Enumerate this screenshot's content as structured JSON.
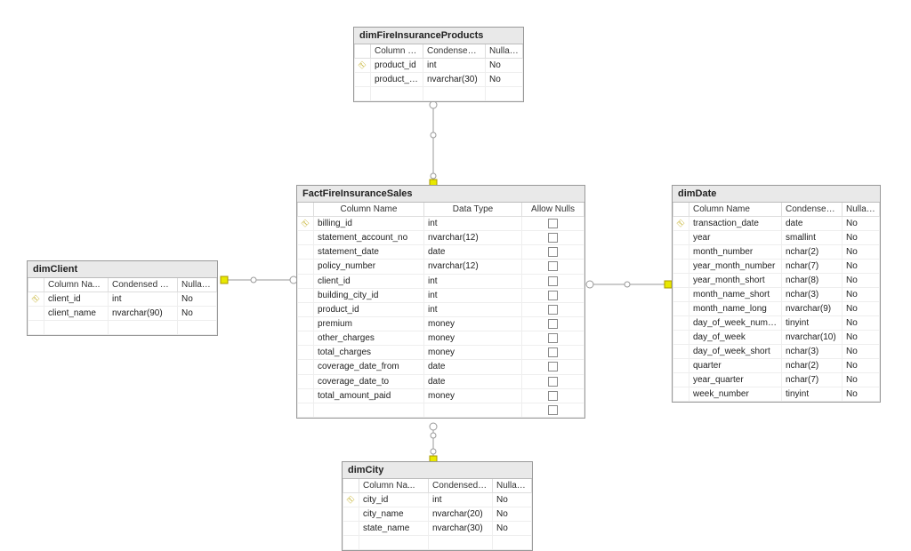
{
  "tables": {
    "dimFireInsuranceProducts": {
      "title": "dimFireInsuranceProducts",
      "headers": [
        "Column Name",
        "Condensed Ty...",
        "Nullable"
      ],
      "rows": [
        {
          "pk": true,
          "c0": "product_id",
          "c1": "int",
          "c2": "No"
        },
        {
          "pk": false,
          "c0": "product_name",
          "c1": "nvarchar(30)",
          "c2": "No"
        }
      ]
    },
    "dimClient": {
      "title": "dimClient",
      "headers": [
        "Column Na...",
        "Condensed Ty...",
        "Nullable"
      ],
      "rows": [
        {
          "pk": true,
          "c0": "client_id",
          "c1": "int",
          "c2": "No"
        },
        {
          "pk": false,
          "c0": "client_name",
          "c1": "nvarchar(90)",
          "c2": "No"
        }
      ]
    },
    "dimCity": {
      "title": "dimCity",
      "headers": [
        "Column Na...",
        "Condensed Ty...",
        "Nullable"
      ],
      "rows": [
        {
          "pk": true,
          "c0": "city_id",
          "c1": "int",
          "c2": "No"
        },
        {
          "pk": false,
          "c0": "city_name",
          "c1": "nvarchar(20)",
          "c2": "No"
        },
        {
          "pk": false,
          "c0": "state_name",
          "c1": "nvarchar(30)",
          "c2": "No"
        }
      ]
    },
    "dimDate": {
      "title": "dimDate",
      "headers": [
        "Column Name",
        "Condensed Ty...",
        "Nullable"
      ],
      "rows": [
        {
          "pk": true,
          "c0": "transaction_date",
          "c1": "date",
          "c2": "No"
        },
        {
          "pk": false,
          "c0": "year",
          "c1": "smallint",
          "c2": "No"
        },
        {
          "pk": false,
          "c0": "month_number",
          "c1": "nchar(2)",
          "c2": "No"
        },
        {
          "pk": false,
          "c0": "year_month_number",
          "c1": "nchar(7)",
          "c2": "No"
        },
        {
          "pk": false,
          "c0": "year_month_short",
          "c1": "nchar(8)",
          "c2": "No"
        },
        {
          "pk": false,
          "c0": "month_name_short",
          "c1": "nchar(3)",
          "c2": "No"
        },
        {
          "pk": false,
          "c0": "month_name_long",
          "c1": "nvarchar(9)",
          "c2": "No"
        },
        {
          "pk": false,
          "c0": "day_of_week_numb...",
          "c1": "tinyint",
          "c2": "No"
        },
        {
          "pk": false,
          "c0": "day_of_week",
          "c1": "nvarchar(10)",
          "c2": "No"
        },
        {
          "pk": false,
          "c0": "day_of_week_short",
          "c1": "nchar(3)",
          "c2": "No"
        },
        {
          "pk": false,
          "c0": "quarter",
          "c1": "nchar(2)",
          "c2": "No"
        },
        {
          "pk": false,
          "c0": "year_quarter",
          "c1": "nchar(7)",
          "c2": "No"
        },
        {
          "pk": false,
          "c0": "week_number",
          "c1": "tinyint",
          "c2": "No"
        }
      ]
    },
    "FactFireInsuranceSales": {
      "title": "FactFireInsuranceSales",
      "headers": [
        "Column Name",
        "Data Type",
        "Allow Nulls"
      ],
      "rows": [
        {
          "pk": true,
          "c0": "billing_id",
          "c1": "int",
          "c2box": true
        },
        {
          "pk": false,
          "c0": "statement_account_no",
          "c1": "nvarchar(12)",
          "c2box": true
        },
        {
          "pk": false,
          "c0": "statement_date",
          "c1": "date",
          "c2box": true
        },
        {
          "pk": false,
          "c0": "policy_number",
          "c1": "nvarchar(12)",
          "c2box": true
        },
        {
          "pk": false,
          "c0": "client_id",
          "c1": "int",
          "c2box": true
        },
        {
          "pk": false,
          "c0": "building_city_id",
          "c1": "int",
          "c2box": true
        },
        {
          "pk": false,
          "c0": "product_id",
          "c1": "int",
          "c2box": true
        },
        {
          "pk": false,
          "c0": "premium",
          "c1": "money",
          "c2box": true
        },
        {
          "pk": false,
          "c0": "other_charges",
          "c1": "money",
          "c2box": true
        },
        {
          "pk": false,
          "c0": "total_charges",
          "c1": "money",
          "c2box": true
        },
        {
          "pk": false,
          "c0": "coverage_date_from",
          "c1": "date",
          "c2box": true
        },
        {
          "pk": false,
          "c0": "coverage_date_to",
          "c1": "date",
          "c2box": true
        },
        {
          "pk": false,
          "c0": "total_amount_paid",
          "c1": "money",
          "c2box": true
        },
        {
          "pk": false,
          "c0": "",
          "c1": "",
          "c2box": true
        }
      ]
    }
  }
}
